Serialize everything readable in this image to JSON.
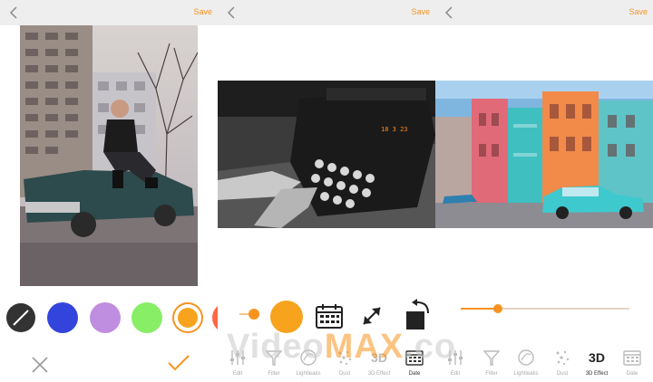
{
  "panels": [
    {
      "save_label": "Save"
    },
    {
      "save_label": "Save"
    },
    {
      "save_label": "Save"
    }
  ],
  "colors": {
    "accent": "#f7931e",
    "swatches": [
      "#333333",
      "#3344dd",
      "#c08ee0",
      "#88ee66",
      "#f7a31e",
      "#ff6644"
    ]
  },
  "photo2": {
    "date_stamp": "18  3  23"
  },
  "toolbar_panel2": [
    {
      "label": "Edit",
      "icon": "sliders-icon"
    },
    {
      "label": "Filter",
      "icon": "filter-icon"
    },
    {
      "label": "Lightleaks",
      "icon": "lightleaks-icon"
    },
    {
      "label": "Dust",
      "icon": "dust-icon"
    },
    {
      "label": "3D Effect",
      "icon": "3d-icon",
      "glyph": "3D"
    },
    {
      "label": "Date",
      "icon": "calendar-icon"
    }
  ],
  "toolbar_panel3": [
    {
      "label": "Edit",
      "icon": "sliders-icon"
    },
    {
      "label": "Filter",
      "icon": "filter-icon"
    },
    {
      "label": "Lightleaks",
      "icon": "lightleaks-icon"
    },
    {
      "label": "Dust",
      "icon": "dust-icon"
    },
    {
      "label": "3D Effect",
      "icon": "3d-icon",
      "glyph": "3D",
      "active": true
    },
    {
      "label": "Date",
      "icon": "calendar-icon"
    }
  ],
  "slider": {
    "value": 0.22
  },
  "watermark": {
    "part1": "Video",
    "part2": "MAX",
    "part3": ".co"
  }
}
